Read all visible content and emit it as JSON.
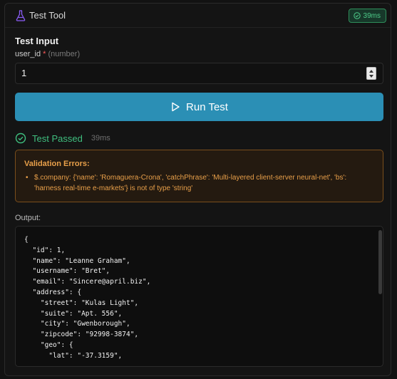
{
  "header": {
    "title": "Test Tool",
    "timing_badge": "39ms",
    "icons": {
      "tool": "flask-icon",
      "badge": "check-circle-icon"
    },
    "accent": "#8b5cf6"
  },
  "test_input": {
    "section_title": "Test Input",
    "field": {
      "name": "user_id",
      "required_marker": "*",
      "type_hint": "(number)",
      "value": "1"
    }
  },
  "run_button": {
    "label": "Run Test",
    "icon": "play-icon",
    "color": "#2b8fb5"
  },
  "result": {
    "status": "Test Passed",
    "duration": "39ms",
    "icon": "check-circle-icon",
    "color": "#3fbf7f"
  },
  "validation": {
    "title": "Validation Errors:",
    "errors": [
      "$.company: {'name': 'Romaguera-Crona', 'catchPhrase': 'Multi-layered client-server neural-net', 'bs': 'harness real-time e-markets'} is not of type 'string'"
    ],
    "color": "#e9a04a"
  },
  "output": {
    "label": "Output:",
    "content": "{\n  \"id\": 1,\n  \"name\": \"Leanne Graham\",\n  \"username\": \"Bret\",\n  \"email\": \"Sincere@april.biz\",\n  \"address\": {\n    \"street\": \"Kulas Light\",\n    \"suite\": \"Apt. 556\",\n    \"city\": \"Gwenborough\",\n    \"zipcode\": \"92998-3874\",\n    \"geo\": {\n      \"lat\": \"-37.3159\","
  }
}
